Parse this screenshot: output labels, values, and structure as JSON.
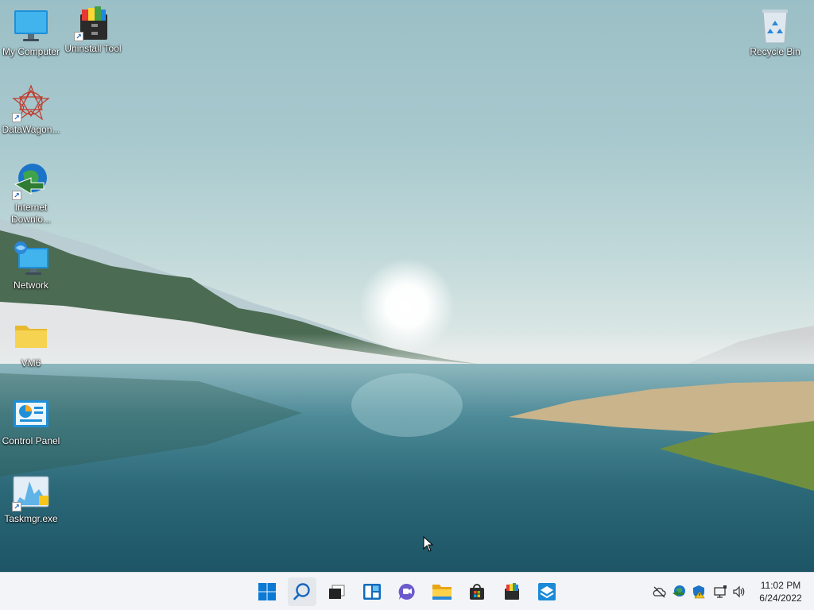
{
  "desktop": {
    "icons": [
      {
        "label": "My Computer",
        "icon": "monitor-icon"
      },
      {
        "label": "Uninstall Tool",
        "icon": "uninstall-tool-icon"
      },
      {
        "label": "DataWagon...",
        "icon": "datawagon-icon"
      },
      {
        "label": "Internet Downlo...",
        "icon": "internet-download-manager-icon"
      },
      {
        "label": "Network",
        "icon": "network-icon"
      },
      {
        "label": "VM6",
        "icon": "folder-icon"
      },
      {
        "label": "Control Panel",
        "icon": "control-panel-icon"
      },
      {
        "label": "Taskmgr.exe",
        "icon": "task-manager-icon"
      },
      {
        "label": "Recycle Bin",
        "icon": "recycle-bin-icon"
      }
    ]
  },
  "taskbar": {
    "apps": [
      "start-icon",
      "search-icon",
      "task-view-icon",
      "widgets-icon",
      "chat-icon",
      "file-explorer-icon",
      "store-icon",
      "app-icon",
      "app-icon"
    ],
    "tray": [
      "onedrive-icon",
      "network-app-icon",
      "security-icon",
      "network-status-icon",
      "volume-icon"
    ],
    "clock": {
      "time": "11:02 PM",
      "date": "6/24/2022"
    }
  },
  "colors": {
    "accent": "#0067c0",
    "taskbar": "#f2f4f7"
  }
}
